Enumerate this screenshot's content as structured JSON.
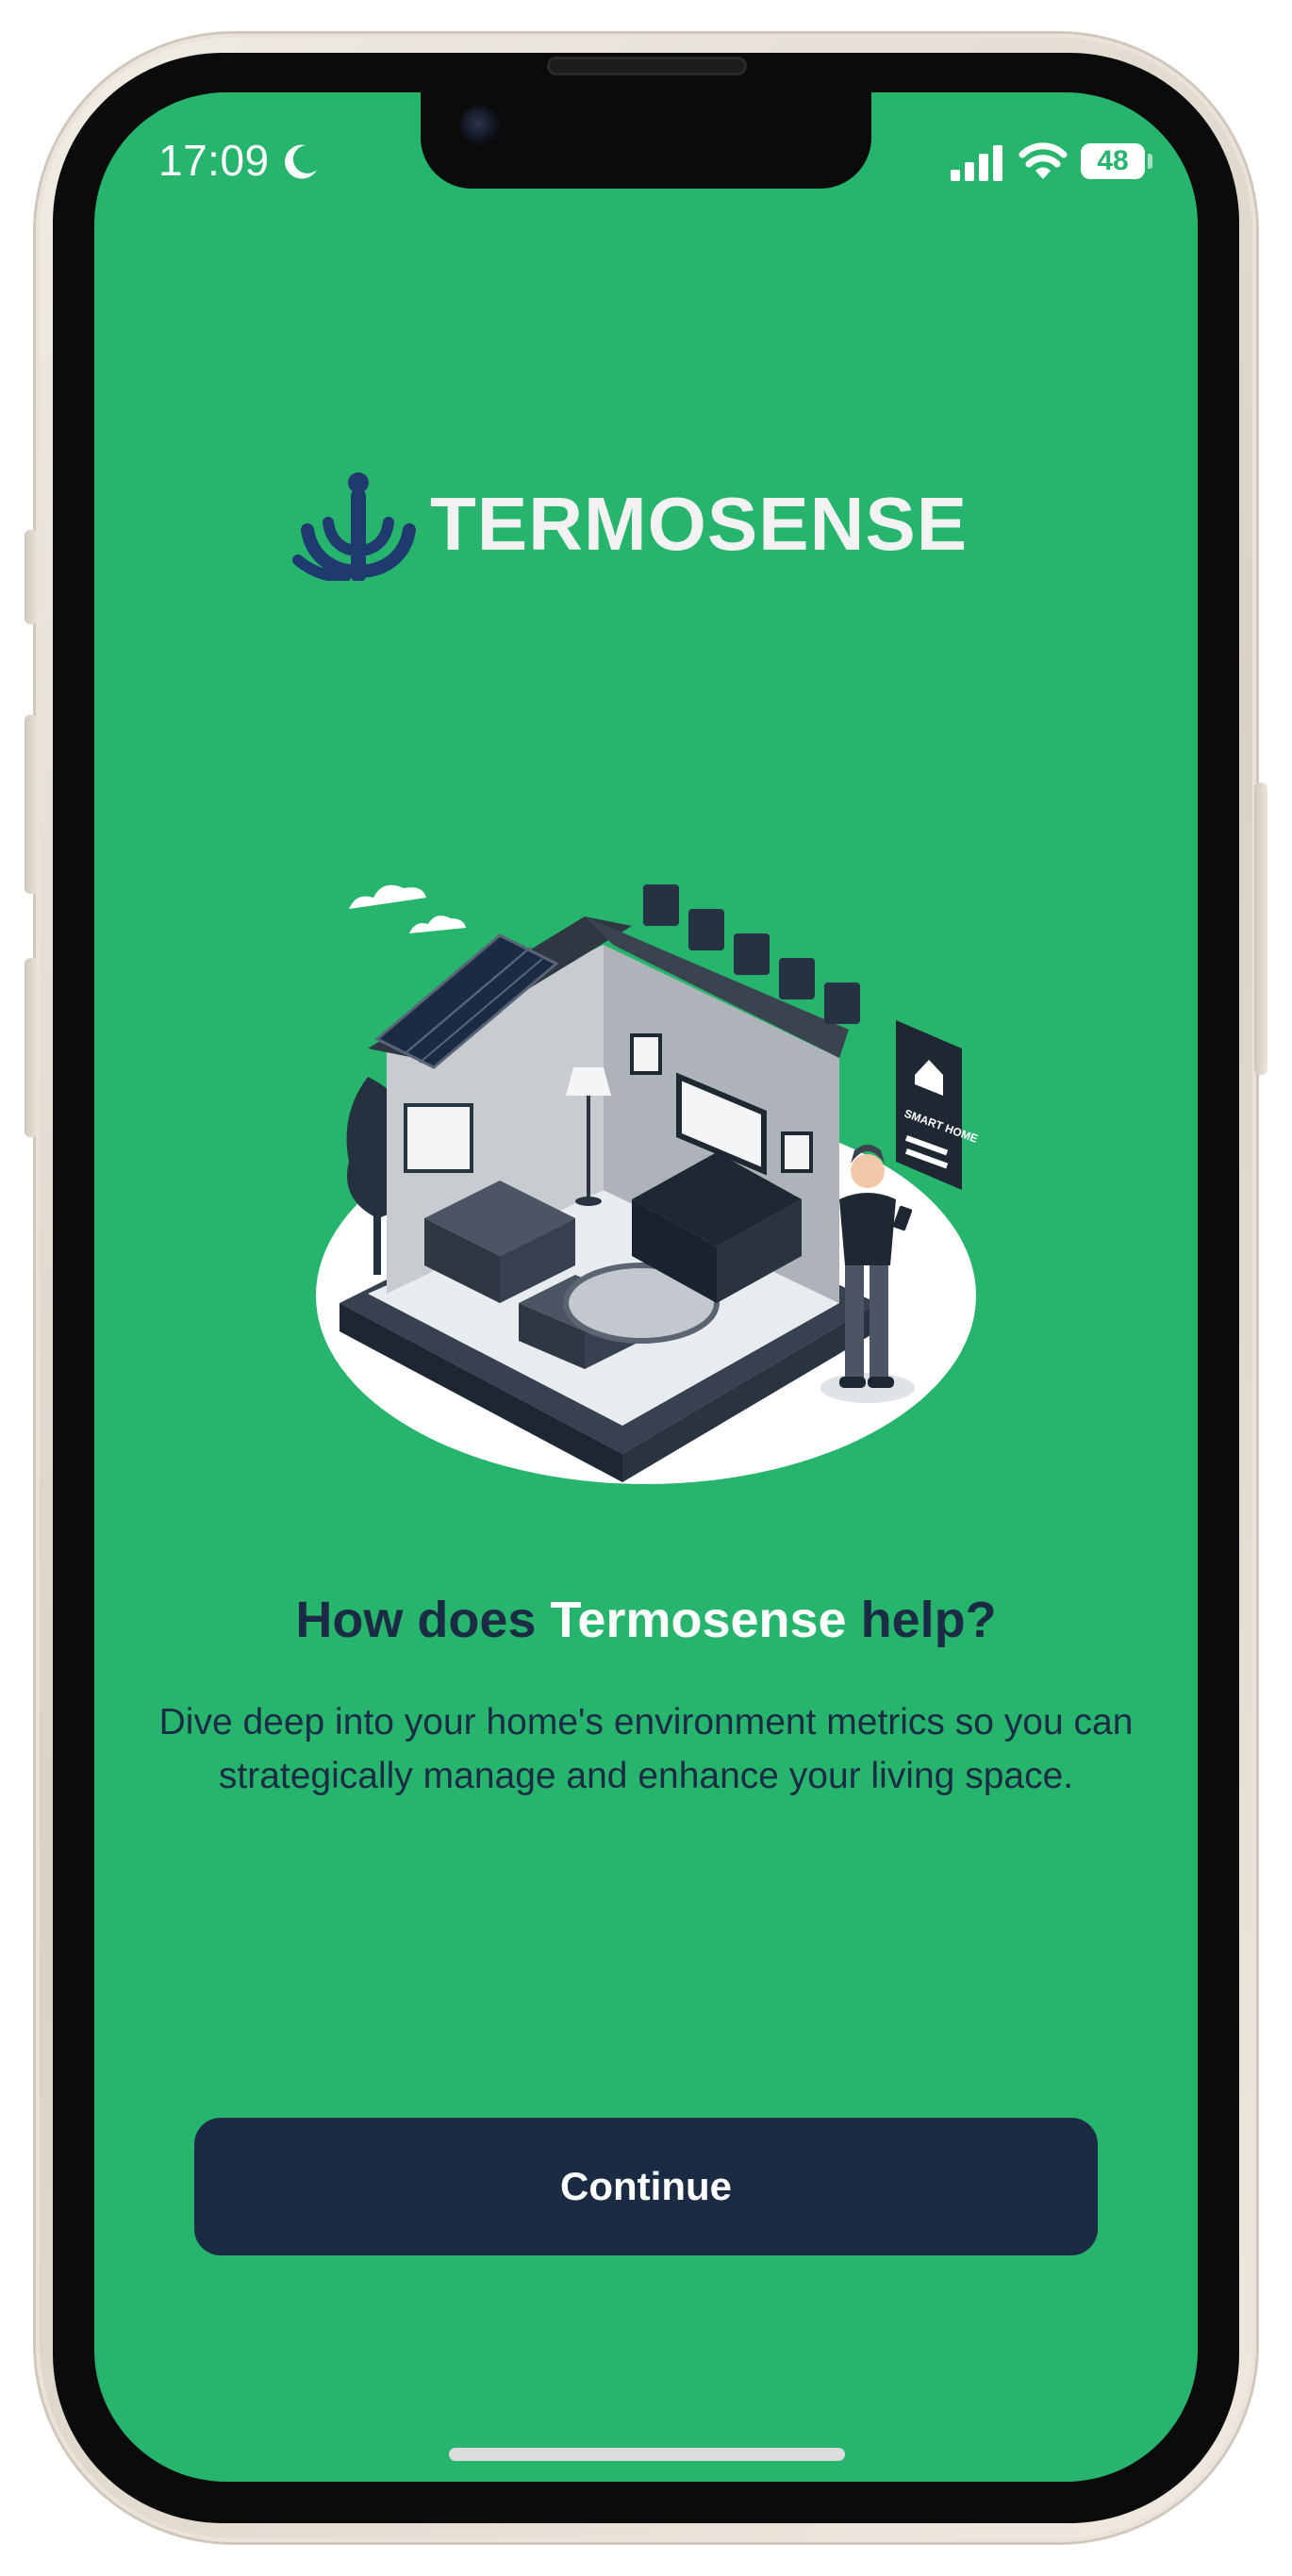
{
  "status_bar": {
    "time": "17:09",
    "battery": "48",
    "icons": [
      "moon-icon",
      "cellular-signal-icon",
      "wifi-icon",
      "battery-icon"
    ]
  },
  "logo": {
    "brand": "TERMOSENSE",
    "mark_icon": "termosense-logo-mark"
  },
  "illustration": {
    "sign_text": "SMART HOME"
  },
  "onboarding": {
    "heading_prefix": "How does ",
    "heading_brand": "Termosense",
    "heading_suffix": " help?",
    "description": "Dive deep into your home's environment metrics so you can strategically manage and enhance your living space."
  },
  "actions": {
    "continue_label": "Continue"
  },
  "colors": {
    "background": "#27b56d",
    "primary": "#1b2b44",
    "accent_text": "#ffffff"
  }
}
